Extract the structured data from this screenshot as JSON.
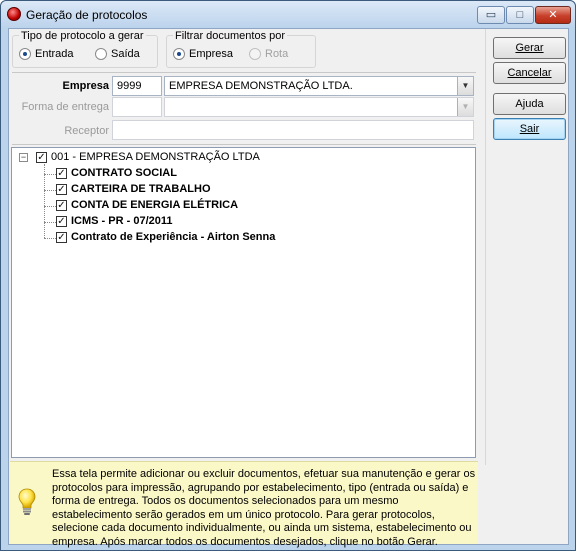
{
  "window": {
    "title": "Geração de protocolos",
    "minimize_glyph": "▭",
    "maximize_glyph": "□",
    "close_glyph": "✕"
  },
  "tipo_protocolo": {
    "title": "Tipo de protocolo a gerar",
    "options": [
      {
        "label": "Entrada",
        "selected": true
      },
      {
        "label": "Saída",
        "selected": false
      }
    ]
  },
  "filtrar": {
    "title": "Filtrar documentos por",
    "options": [
      {
        "label": "Empresa",
        "selected": true,
        "enabled": true
      },
      {
        "label": "Rota",
        "selected": false,
        "enabled": false
      }
    ]
  },
  "form": {
    "empresa_label": "Empresa",
    "empresa_code": "9999",
    "empresa_name": "EMPRESA DEMONSTRAÇÃO LTDA.",
    "forma_entrega_label": "Forma de entrega",
    "forma_entrega_code": "",
    "forma_entrega_name": "",
    "receptor_label": "Receptor",
    "receptor_value": ""
  },
  "buttons": {
    "gerar": "Gerar",
    "cancelar": "Cancelar",
    "ajuda": "Ajuda",
    "sair": "Sair"
  },
  "tree": {
    "root": {
      "label": "001 - EMPRESA DEMONSTRAÇÃO LTDA",
      "checked": true,
      "expanded": true
    },
    "children": [
      {
        "label": "CONTRATO SOCIAL",
        "checked": true
      },
      {
        "label": "CARTEIRA DE TRABALHO",
        "checked": true
      },
      {
        "label": "CONTA DE ENERGIA ELÉTRICA",
        "checked": true
      },
      {
        "label": "ICMS - PR - 07/2011",
        "checked": true
      },
      {
        "label": "Contrato de Experiência - Airton Senna",
        "checked": true
      }
    ]
  },
  "help": {
    "icon": "lightbulb-icon",
    "text": "Essa tela permite adicionar ou excluir documentos, efetuar sua manutenção e gerar os protocolos para impressão, agrupando por estabelecimento, tipo (entrada ou saída) e forma de entrega. Todos os documentos selecionados para um mesmo estabelecimento serão gerados em um único protocolo. Para gerar protocolos, selecione cada documento individualmente, ou ainda um sistema,  estabelecimento ou empresa. Após marcar todos os documentos desejados, clique no botão Gerar."
  }
}
